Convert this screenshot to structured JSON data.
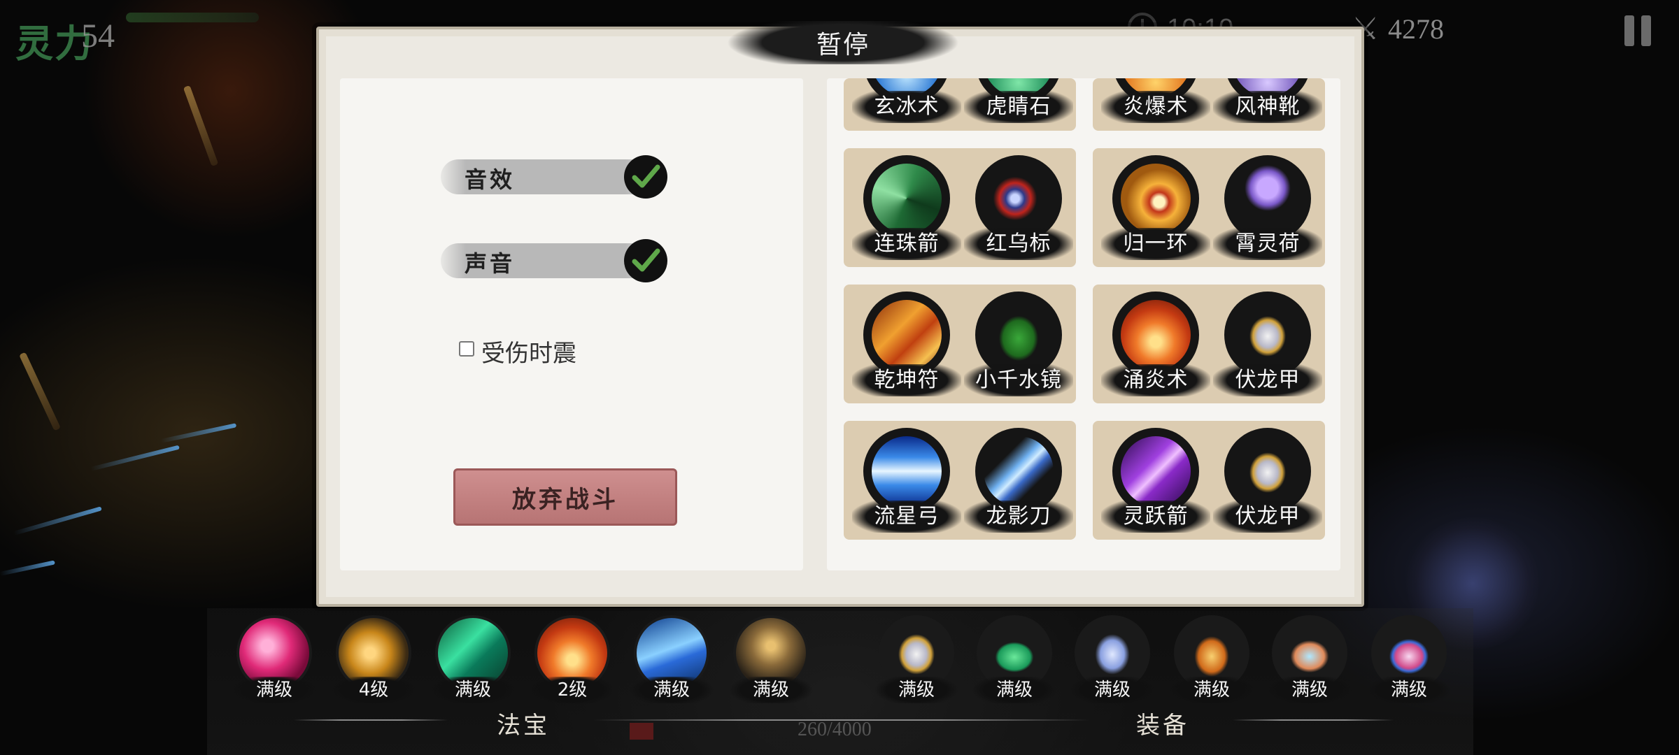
{
  "hud": {
    "lingli_label": "灵力",
    "lingli_value": "54",
    "timer": "10:10",
    "kills": "4278"
  },
  "dialog": {
    "title": "暂停",
    "settings": {
      "sound_effects_label": "音效",
      "sound_effects_on": true,
      "voice_label": "声音",
      "voice_on": true,
      "vibrate_label": "受伤时震",
      "vibrate_on": false,
      "abandon_label": "放弃战斗"
    },
    "combos": [
      {
        "left": "玄冰术",
        "right": "虎睛石",
        "left_icon": "ice-orb-icon",
        "right_icon": "tiger-stone-icon"
      },
      {
        "left": "炎爆术",
        "right": "风神靴",
        "left_icon": "fire-burst-icon",
        "right_icon": "wind-boots-icon"
      },
      {
        "left": "连珠箭",
        "right": "红乌标",
        "left_icon": "triple-arrow-icon",
        "right_icon": "red-dart-icon"
      },
      {
        "left": "归一环",
        "right": "霄灵荷",
        "left_icon": "spirit-ring-icon",
        "right_icon": "lotus-pot-icon"
      },
      {
        "left": "乾坤符",
        "right": "小千水镜",
        "left_icon": "talisman-icon",
        "right_icon": "water-mirror-icon"
      },
      {
        "left": "涌炎术",
        "right": "伏龙甲",
        "left_icon": "flame-surge-icon",
        "right_icon": "dragon-armor-icon"
      },
      {
        "left": "流星弓",
        "right": "龙影刀",
        "left_icon": "meteor-bow-icon",
        "right_icon": "dragon-blade-icon"
      },
      {
        "left": "灵跃箭",
        "right": "伏龙甲",
        "left_icon": "spirit-arrow-icon",
        "right_icon": "dragon-armor-icon"
      }
    ]
  },
  "bottom": {
    "fabao_label": "法宝",
    "equip_label": "装备",
    "xp_text": "260/4000",
    "xp_progress": 0.065,
    "fabao_slots": [
      {
        "level": "满级",
        "icon": "crimson-vortex-icon"
      },
      {
        "level": "4级",
        "icon": "golden-swirl-icon"
      },
      {
        "level": "满级",
        "icon": "jade-blades-icon"
      },
      {
        "level": "2级",
        "icon": "flame-dome-icon"
      },
      {
        "level": "满级",
        "icon": "blue-rain-icon"
      },
      {
        "level": "满级",
        "icon": "shadow-runner-icon"
      }
    ],
    "equip_slots": [
      {
        "level": "满级",
        "icon": "dragon-armor-icon"
      },
      {
        "level": "满级",
        "icon": "jade-box-icon"
      },
      {
        "level": "满级",
        "icon": "boots-icon"
      },
      {
        "level": "满级",
        "icon": "gold-pouch-icon"
      },
      {
        "level": "满级",
        "icon": "jade-box-open-icon"
      },
      {
        "level": "满级",
        "icon": "gem-box-icon"
      }
    ]
  },
  "colors": {
    "panel": "#f6f5f2",
    "combo_card": "#dcccb1",
    "abandon_button": "#c58080",
    "check_green": "#5fa84a"
  }
}
